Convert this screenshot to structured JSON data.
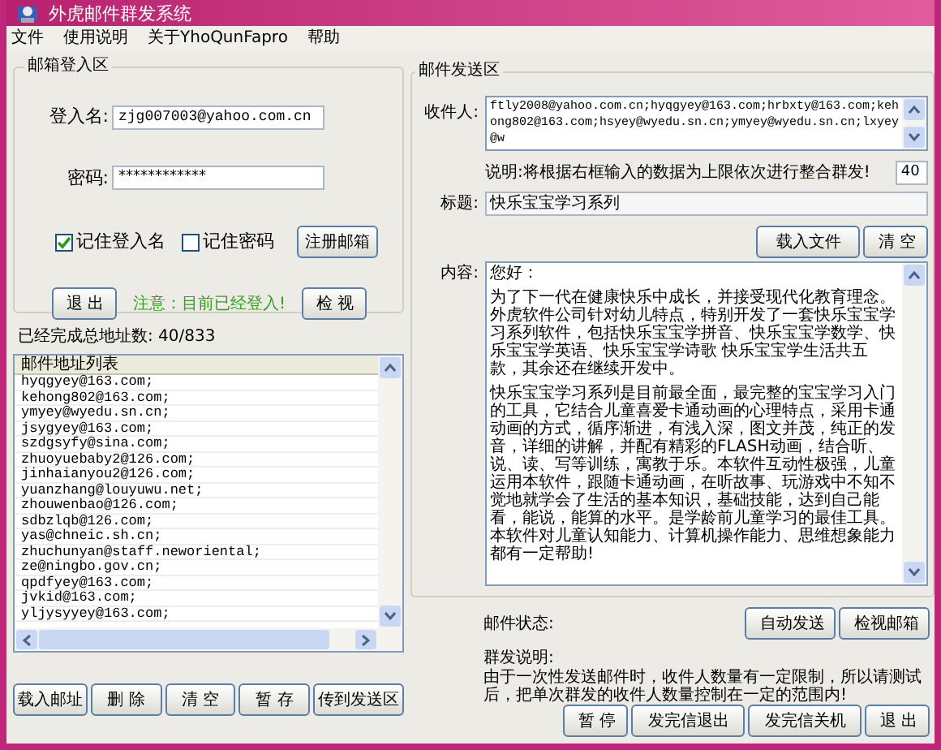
{
  "window": {
    "title": "外虎邮件群发系统"
  },
  "menu": [
    "文件",
    "使用说明",
    "关于YhoQunFapro",
    "帮助"
  ],
  "login": {
    "legend": "邮箱登入区",
    "username_label": "登入名:",
    "username": "zjg007003@yahoo.com.cn",
    "password_label": "密码:",
    "password": "************",
    "checkboxes": [
      {
        "label": "记住登入名",
        "checked": true
      },
      {
        "label": "记住密码",
        "checked": false
      }
    ],
    "register_button": "注册邮箱",
    "logout_button": "退 出",
    "status": "注意：目前已经登入!",
    "view_button": "检 视"
  },
  "progress_label": "已经完成总地址数: 40/833",
  "address_list": {
    "header": "邮件地址列表",
    "rows": [
      "hyqgyey@163.com;",
      "kehong802@163.com;",
      "ymyey@wyedu.sn.cn;",
      "jsygyey@163.com;",
      "szdgsyfy@sina.com;",
      "zhuoyuebaby2@126.com;",
      "jinhaianyou2@126.com;",
      "yuanzhang@louyuwu.net;",
      "zhouwenbao@126.com;",
      "sdbzlqb@126.com;",
      "yas@chneic.sh.cn;",
      "zhuchunyan@staff.neworiental;",
      "ze@ningbo.gov.cn;",
      "qpdfyey@163.com;",
      "jvkid@163.com;",
      "yljysyyey@163.com;"
    ]
  },
  "left_buttons": [
    "载入邮址",
    "删 除",
    "清 空",
    "暂 存",
    "传到发送区"
  ],
  "send": {
    "legend": "邮件发送区",
    "recipients_label": "收件人:",
    "recipients": "ftly2008@yahoo.com.cn;hyqgyey@163.com;hrbxty@163.com;kehong802@163.com;hsyey@wyedu.sn.cn;ymyey@wyedu.sn.cn;lxyey@w",
    "note": "说明:将根据右框输入的数据为上限依次进行整合群发!",
    "limit": "40",
    "subject_label": "标题:",
    "subject": "快乐宝宝学习系列",
    "file_buttons": [
      "载入文件",
      "清 空"
    ],
    "content_label": "内容:",
    "content": [
      "您好：",
      "为了下一代在健康快乐中成长，并接受现代化教育理念。外虎软件公司针对幼儿特点，特别开发了一套快乐宝宝学习系列软件，包括快乐宝宝学拼音、快乐宝宝学数学、快乐宝宝学英语、快乐宝宝学诗歌 快乐宝宝学生活共五款，其余还在继续开发中。",
      "快乐宝宝学习系列是目前最全面，最完整的宝宝学习入门的工具，它结合儿童喜爱卡通动画的心理特点，采用卡通动画的方式，循序渐进，有浅入深，图文并茂，纯正的发音，详细的讲解，并配有精彩的FLASH动画，结合听、说、读、写等训练，寓教于乐。本软件互动性极强，儿童运用本软件，跟随卡通动画，在听故事、玩游戏中不知不觉地就学会了生活的基本知识，基础技能，达到自己能看，能说，能算的水平。是学龄前儿童学习的最佳工具。本软件对儿童认知能力、计算机操作能力、思维想象能力都有一定帮助!"
    ],
    "status_label": "邮件状态:",
    "status_buttons": [
      "自动发送",
      "检视邮箱"
    ],
    "explanation_title": "群发说明:",
    "explanation": "由于一次性发送邮件时，收件人数量有一定限制，所以请测试后，把单次群发的收件人数量控制在一定的范围内!"
  },
  "bottom_buttons": [
    "暂 停",
    "发完信退出",
    "发完信关机",
    "退 出"
  ]
}
